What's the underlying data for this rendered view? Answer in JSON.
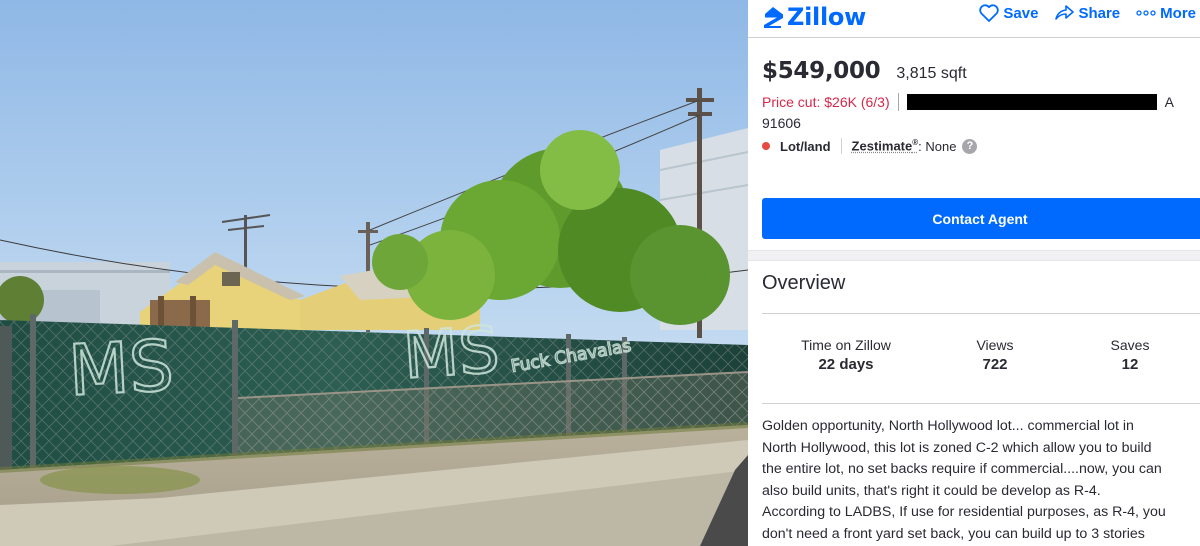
{
  "photo": {
    "graffiti": [
      "MS",
      "MS",
      "Fuck Chavalas"
    ]
  },
  "header": {
    "brand": "Zillow",
    "actions": [
      {
        "label": "Save",
        "icon": "heart-icon"
      },
      {
        "label": "Share",
        "icon": "share-icon"
      },
      {
        "label": "More",
        "icon": "more-dots-icon"
      }
    ]
  },
  "listing": {
    "price": "$549,000",
    "sqft": "3,815 sqft",
    "price_cut": "Price cut: $26K (6/3)",
    "address_tail": "A",
    "zip": "91606",
    "type": "Lot/land",
    "zestimate_label": "Zestimate",
    "zestimate_mark": "®",
    "zestimate_value": ": None",
    "help": "?"
  },
  "contact_button": "Contact Agent",
  "overview": {
    "title": "Overview",
    "stats": [
      {
        "label": "Time on Zillow",
        "value": "22 days"
      },
      {
        "label": "Views",
        "value": "722"
      },
      {
        "label": "Saves",
        "value": "12"
      }
    ],
    "description_lines": [
      "Golden opportunity, North Hollywood lot... commercial lot in",
      "North Hollywood, this lot is zoned C-2 which allow you to build",
      "the entire lot, no set backs require if commercial....now, you can",
      "also build units, that's right it could be develop as R-4.",
      "According to LADBS, If use for residential purposes, as R-4, you",
      "don't need a front yard set back, you can build up to 3 stories"
    ]
  },
  "colors": {
    "brand_blue": "#006aff",
    "price_cut_red": "#d4284c",
    "status_dot": "#e54b40"
  }
}
